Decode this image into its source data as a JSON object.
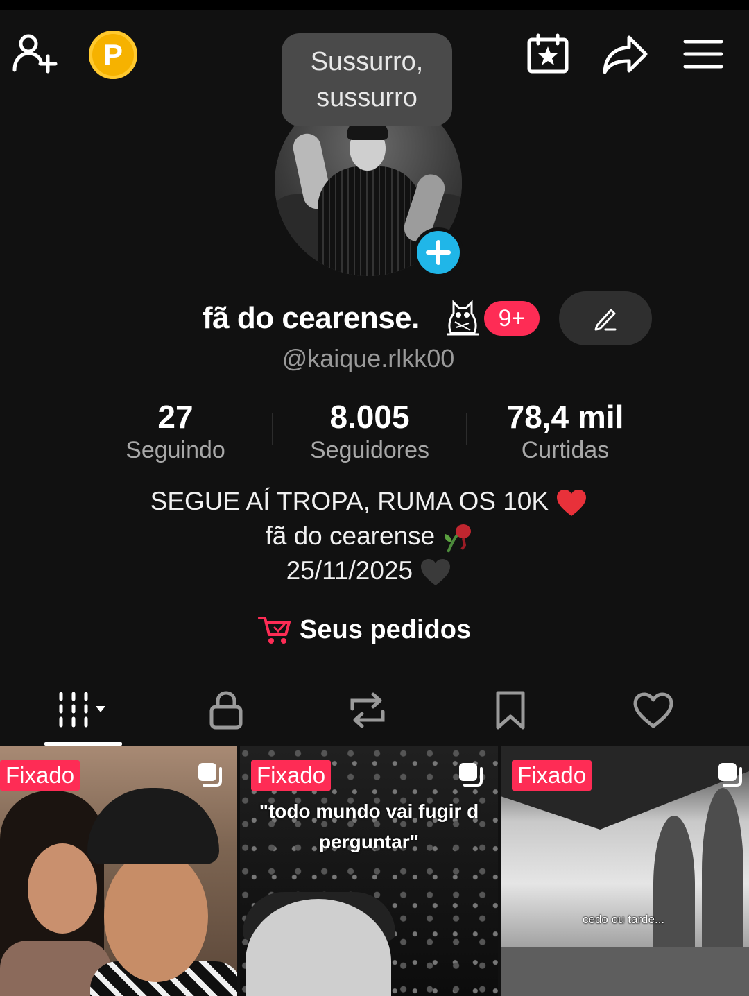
{
  "header": {
    "tooltip_line1": "Sussurro,",
    "tooltip_line2": "sussurro",
    "points_letter": "P",
    "icons": [
      "add-user-icon",
      "points-icon",
      "calendar-star-icon",
      "share-icon",
      "menu-icon"
    ]
  },
  "profile": {
    "display_name": "fã do cearense.",
    "notifications_badge": "9+",
    "handle": "@kaique.rlkk00"
  },
  "stats": {
    "following": {
      "value": "27",
      "label": "Seguindo"
    },
    "followers": {
      "value": "8.005",
      "label": "Seguidores"
    },
    "likes": {
      "value": "78,4 mil",
      "label": "Curtidas"
    }
  },
  "bio": {
    "line1": "SEGUE AÍ TROPA, RUMA OS 10K",
    "line2": "fã do cearense",
    "line3": "25/11/2025"
  },
  "orders": {
    "label": "Seus pedidos"
  },
  "tabs": [
    "videos-grid",
    "private",
    "reposts",
    "saved",
    "liked"
  ],
  "grid": {
    "tiles": [
      {
        "pin_label": "Fixado"
      },
      {
        "pin_label": "Fixado",
        "caption_line1": "\"todo mundo vai fugir d",
        "caption_line2": "perguntar\""
      },
      {
        "pin_label": "Fixado",
        "caption": "cedo ou tarde..."
      }
    ]
  },
  "colors": {
    "background": "#111111",
    "accent_pink": "#fe2c55",
    "avatar_add_blue": "#20b6e8",
    "points_gold": "#f6b200"
  }
}
